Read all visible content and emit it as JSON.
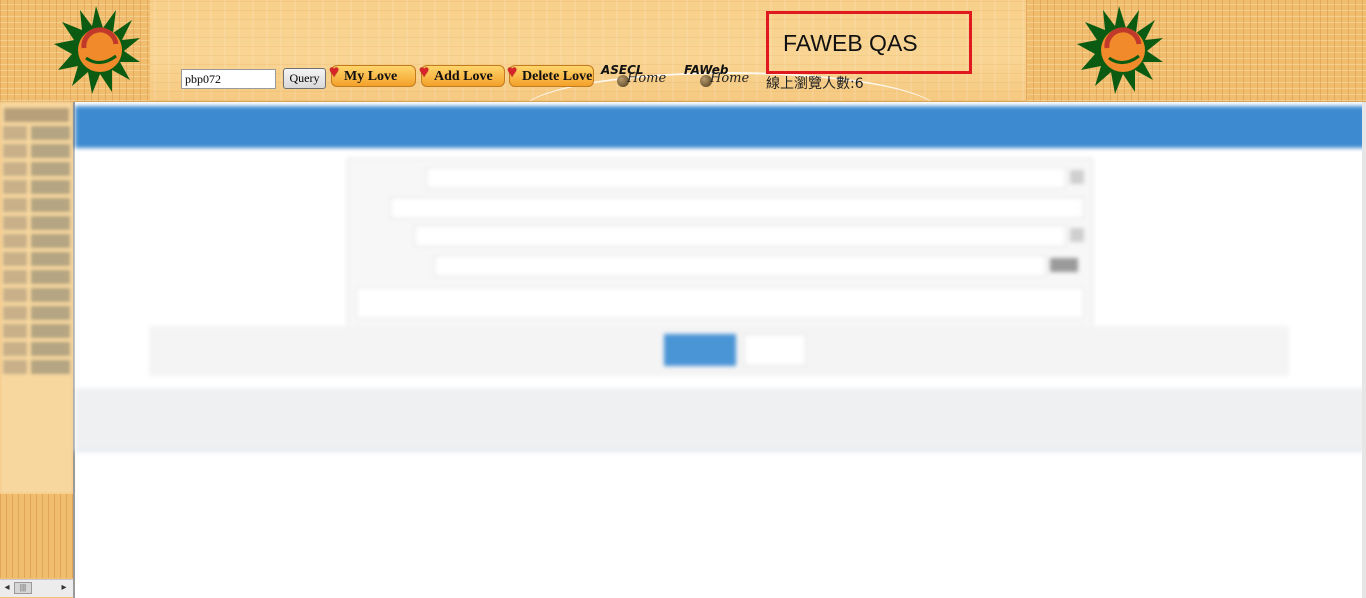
{
  "header": {
    "user_id_value": "pbp072",
    "query_label": "Query",
    "my_love_label": "My Love",
    "add_love_label": "Add Love",
    "delete_love_label": "Delete Love",
    "asecl_home": {
      "brand": "ASECL",
      "script": "Home"
    },
    "faweb_home": {
      "brand": "FAWeb",
      "script": "Home"
    },
    "online_count_label": "線上瀏覽人數:6",
    "environment_label": "FAWEB QAS",
    "env_box_color": "#e0181f",
    "heart_icon": "heart-icon",
    "logo_icon": "sun-logo-icon"
  },
  "left_frame": {
    "scroll_left_arrow": "◂",
    "scroll_thumb_grip": "|||",
    "scroll_right_arrow": "▸"
  },
  "colors": {
    "banner_bg": "#f9d594",
    "title_bar": "#3d8ad0",
    "primary_button": "#4a95d6"
  }
}
